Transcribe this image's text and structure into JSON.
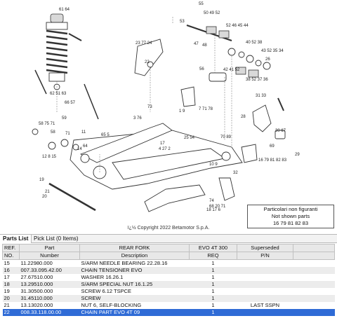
{
  "diagram": {
    "callouts": [
      "55",
      "61 64",
      "50 49 52",
      "52 46 45 44",
      "53",
      "23 77 24",
      "47",
      "48",
      "22",
      "43 52 35 34",
      "40 52 38",
      "56",
      "42 41 52",
      "26",
      "38 52 37 36",
      "62 51 63",
      "66 57",
      "58 75 71",
      "3 76",
      "1 9",
      "7 71 78",
      "31 33",
      "28",
      "30 67",
      "69",
      "29",
      "16 79 81 82 83",
      "58",
      "59",
      "71",
      "64",
      "65 5",
      "12 8 15",
      "14",
      "11",
      "21",
      "17",
      "25 54",
      "70 89",
      "10 9",
      "32",
      "4 27 2",
      "19",
      "20",
      "18 17 6",
      "68 20 71",
      "74",
      "73",
      "72",
      "46"
    ],
    "copyright": "ï¿½ Copyright 2022 Betamotor S.p.A.",
    "not_shown_line1": "Particolari non figuranti",
    "not_shown_line2": "Not shown parts",
    "not_shown_refs": "16 79 81 82 83"
  },
  "tabs": [
    {
      "label": "Parts List",
      "active": true
    },
    {
      "label": "Pick List (0 Items)",
      "active": false
    }
  ],
  "table": {
    "header_top": [
      "REF.",
      "Part",
      "REAR FORK",
      "EVO 4T 300",
      "Superseded"
    ],
    "header_bottom": [
      "NO.",
      "Number",
      "Description",
      "REQ",
      "P/N"
    ],
    "rows": [
      {
        "ref": "15",
        "number": "11.22980.000",
        "desc": "S/ARM NEEDLE BEARING 22.28.16",
        "req": "1",
        "ss": ""
      },
      {
        "ref": "16",
        "number": "007.33.095.42.00",
        "desc": "CHAIN TENSIONER EVO",
        "req": "1",
        "ss": ""
      },
      {
        "ref": "17",
        "number": "27.67510.000",
        "desc": "WASHER 16.26.1",
        "req": "1",
        "ss": ""
      },
      {
        "ref": "18",
        "number": "13.29510.000",
        "desc": "S/ARM SPECIAL NUT 16.1.25",
        "req": "1",
        "ss": ""
      },
      {
        "ref": "19",
        "number": "31.30500.000",
        "desc": "SCREW 6.12 TSPCE",
        "req": "1",
        "ss": ""
      },
      {
        "ref": "20",
        "number": "31.45110.000",
        "desc": "SCREW",
        "req": "1",
        "ss": ""
      },
      {
        "ref": "21",
        "number": "13.13020.000",
        "desc": "NUT 6, SELF-BLOCKING",
        "req": "1",
        "ss": "LAST SSPN"
      },
      {
        "ref": "22",
        "number": "008.33.118.00.00",
        "desc": "CHAIN PART EVO 4T 09",
        "req": "1",
        "ss": "",
        "selected": true
      }
    ]
  }
}
